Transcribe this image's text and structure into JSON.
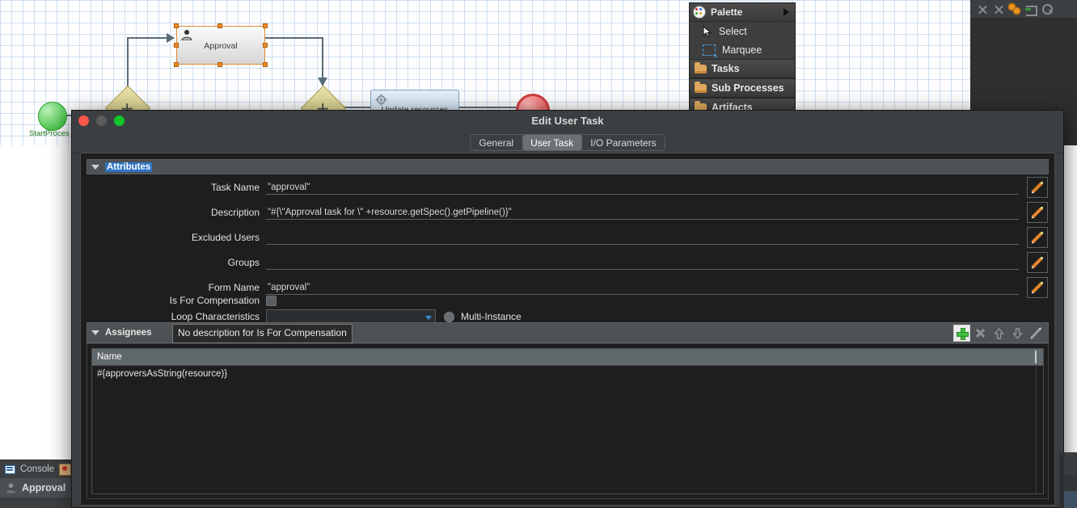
{
  "window": {
    "dialog_title": "Edit User Task",
    "traffic_lights": [
      "close",
      "minimize",
      "zoom"
    ]
  },
  "toolbar_top_right": {
    "icons": [
      "close-icon",
      "close-all-icon",
      "sync-gears-icon",
      "minimize-panel-icon",
      "search-scope-icon"
    ]
  },
  "palette": {
    "title": "Palette",
    "tools": [
      {
        "label": "Select",
        "icon": "cursor-icon"
      },
      {
        "label": "Marquee",
        "icon": "marquee-icon"
      }
    ],
    "groups": [
      {
        "label": "Tasks",
        "icon": "folder-icon"
      },
      {
        "label": "Sub Processes",
        "icon": "folder-icon"
      },
      {
        "label": "Artifacts",
        "icon": "folder-icon"
      }
    ]
  },
  "diagram": {
    "start_event_label": "StartProces",
    "task_approval_label": "Approval",
    "task_service_label": "Update resources",
    "gateway_marks": [
      "✕",
      "✕"
    ]
  },
  "tabs": [
    {
      "label": "General",
      "active": false
    },
    {
      "label": "User Task",
      "active": true
    },
    {
      "label": "I/O Parameters",
      "active": false
    }
  ],
  "attributes": {
    "section_title": "Attributes",
    "fields": [
      {
        "label": "Task Name",
        "value": "\"approval\"",
        "placeholder": ""
      },
      {
        "label": "Description",
        "value": "\"#{\\\"Approval task for \\\" +resource.getSpec().getPipeline()}\"",
        "placeholder": ""
      },
      {
        "label": "Excluded Users",
        "value": "",
        "placeholder": ""
      },
      {
        "label": "Groups",
        "value": "",
        "placeholder": ""
      },
      {
        "label": "Form Name",
        "value": "\"approval\"",
        "placeholder": ""
      }
    ],
    "is_for_compensation_label": "Is For Compensation",
    "is_for_compensation_checked": false,
    "loop_characteristics_label": "Loop Characteristics",
    "loop_characteristics_value": "",
    "multi_instance_label": "Multi-Instance",
    "multi_instance_selected": false
  },
  "tooltip": {
    "text": "No description for Is For Compensation"
  },
  "assignees": {
    "section_title": "Assignees",
    "toolbar": [
      {
        "name": "add",
        "icon": "plus-icon",
        "enabled": true
      },
      {
        "name": "delete",
        "icon": "x-icon",
        "enabled": false
      },
      {
        "name": "move-up",
        "icon": "arrow-up-icon",
        "enabled": false
      },
      {
        "name": "move-down",
        "icon": "arrow-down-icon",
        "enabled": false
      },
      {
        "name": "edit",
        "icon": "pencil-icon",
        "enabled": false
      }
    ],
    "columns": [
      "Name"
    ],
    "rows": [
      {
        "name": "#{approversAsString(resource)}"
      }
    ]
  },
  "console": {
    "tab_label": "Console",
    "item_label": "Approval"
  },
  "colors": {
    "accent_blue": "#2f72c4",
    "pencil_orange": "#e8882a",
    "add_green": "#3fbf3f",
    "dialog_bg": "#3c3f41",
    "content_bg": "#1e1e1e",
    "header_bg": "#4e5254"
  }
}
